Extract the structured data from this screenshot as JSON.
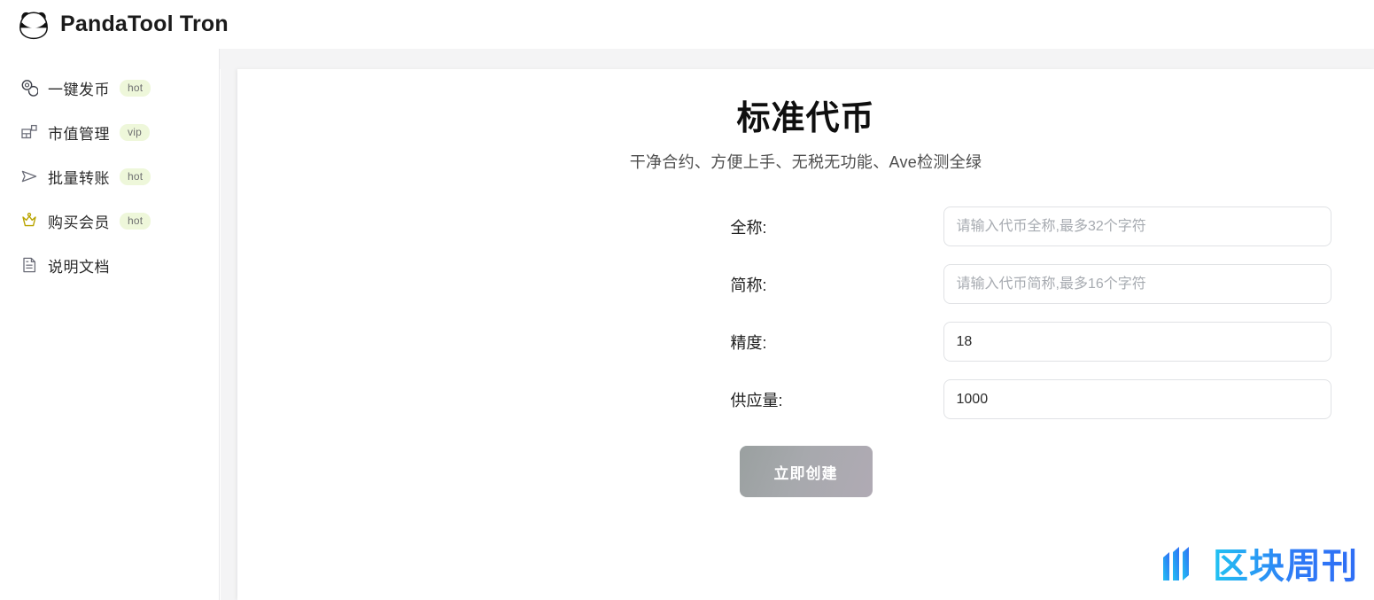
{
  "header": {
    "logo_icon": "panda-icon",
    "title": "PandaTool Tron"
  },
  "sidebar": {
    "items": [
      {
        "icon": "coins-icon",
        "label": "一键发币",
        "badge": "hot"
      },
      {
        "icon": "dashboard-icon",
        "label": "市值管理",
        "badge": "vip"
      },
      {
        "icon": "send-icon",
        "label": "批量转账",
        "badge": "hot"
      },
      {
        "icon": "crown-icon",
        "label": "购买会员",
        "badge": "hot"
      },
      {
        "icon": "document-icon",
        "label": "说明文档",
        "badge": ""
      }
    ]
  },
  "main": {
    "title": "标准代币",
    "subtitle": "干净合约、方便上手、无税无功能、Ave检测全绿",
    "fields": [
      {
        "label": "全称:",
        "value": "",
        "placeholder": "请输入代币全称,最多32个字符"
      },
      {
        "label": "简称:",
        "value": "",
        "placeholder": "请输入代币简称,最多16个字符"
      },
      {
        "label": "精度:",
        "value": "18",
        "placeholder": ""
      },
      {
        "label": "供应量:",
        "value": "1000",
        "placeholder": ""
      }
    ],
    "submit_label": "立即创建"
  },
  "watermark": {
    "logo_icon": "bars-icon",
    "text": "区块周刊"
  },
  "colors": {
    "badge_bg": "#eef7da",
    "badge_text": "#6f7071",
    "crown": "#b9a400",
    "icon_gray": "#6b6d78",
    "panel_gray": "#f4f4f5",
    "watermark_cyan": "#22c3f2",
    "watermark_blue": "#2e7bf6"
  }
}
